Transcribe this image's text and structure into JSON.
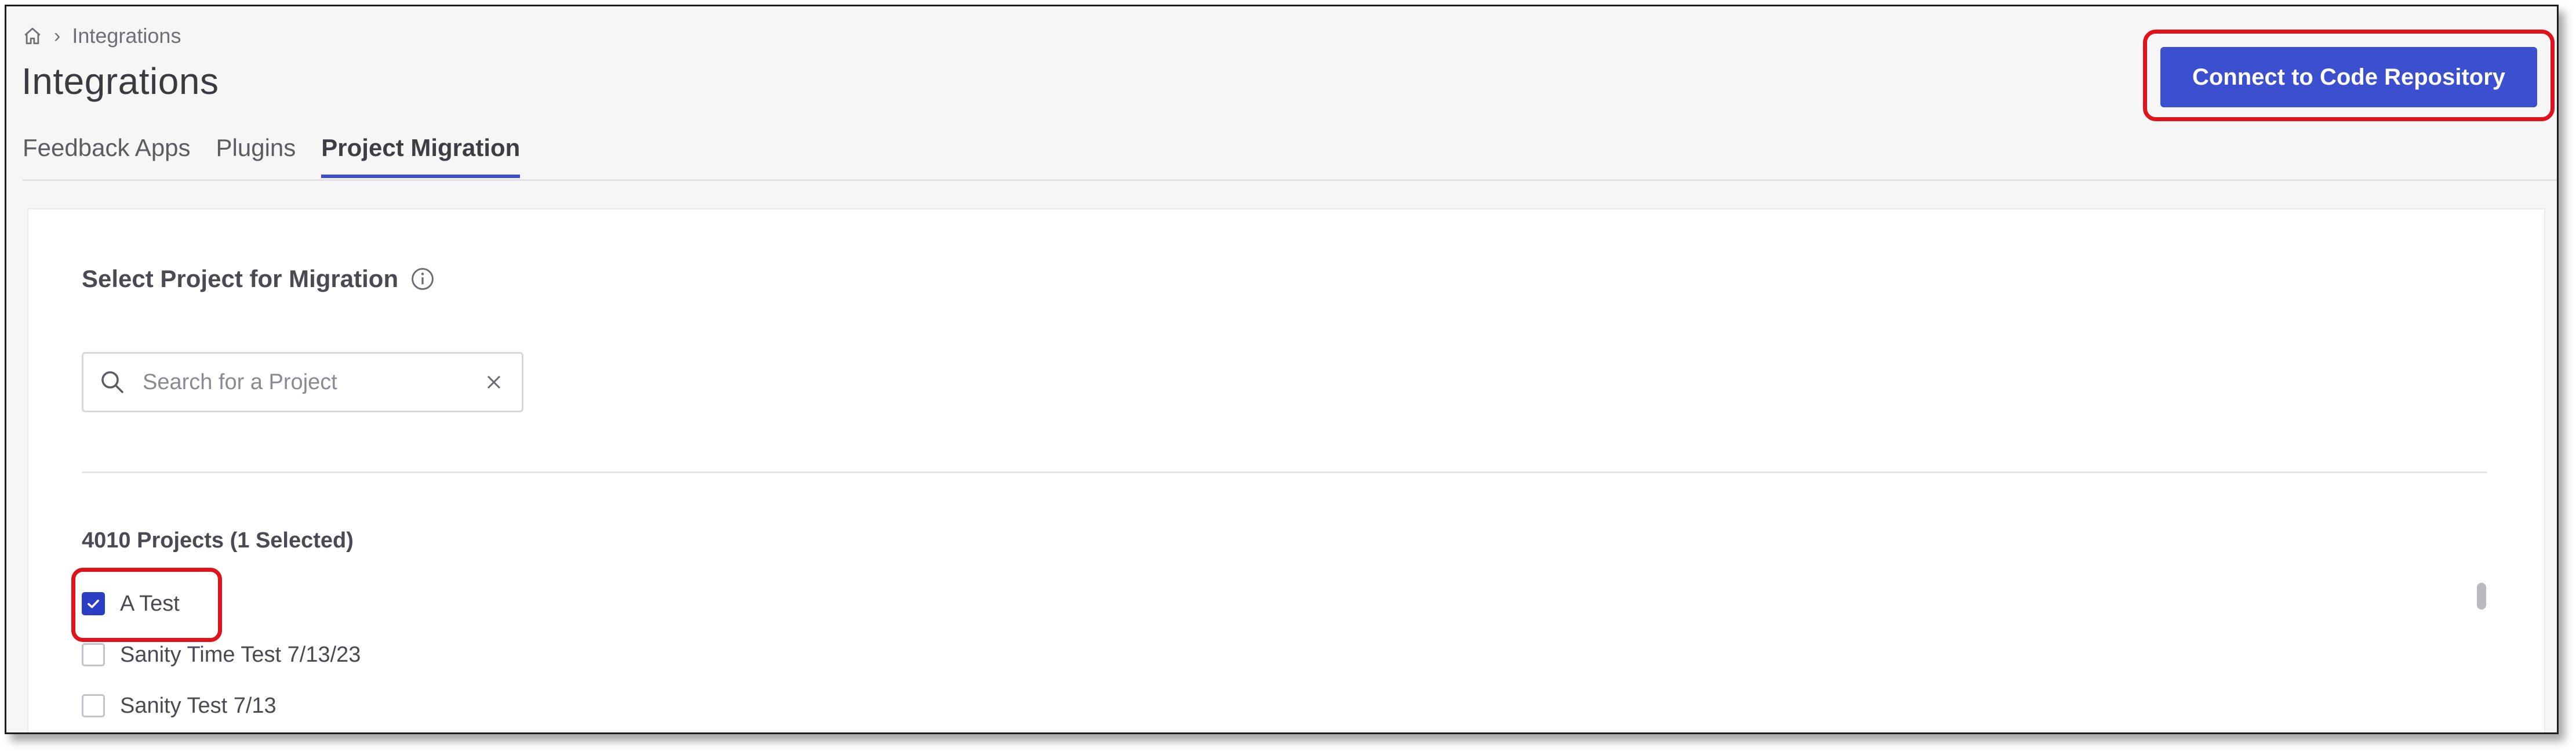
{
  "breadcrumb": {
    "home_icon": "home-icon",
    "separator": "›",
    "current": "Integrations"
  },
  "page": {
    "title": "Integrations"
  },
  "tabs": [
    {
      "label": "Feedback Apps",
      "active": false
    },
    {
      "label": "Plugins",
      "active": false
    },
    {
      "label": "Project Migration",
      "active": true
    }
  ],
  "header": {
    "connect_button_label": "Connect to Code Repository"
  },
  "migration": {
    "section_title": "Select Project for Migration",
    "info_icon": "info-icon",
    "search": {
      "placeholder": "Search for a Project",
      "value": ""
    },
    "projects_summary": "4010 Projects (1 Selected)",
    "projects": [
      {
        "name": "A Test",
        "checked": true
      },
      {
        "name": "Sanity Time Test 7/13/23",
        "checked": false
      },
      {
        "name": "Sanity Test 7/13",
        "checked": false
      }
    ]
  },
  "colors": {
    "accent": "#3b4fcf",
    "checkbox_checked": "#2b3fc4",
    "highlight": "#e0121b"
  }
}
